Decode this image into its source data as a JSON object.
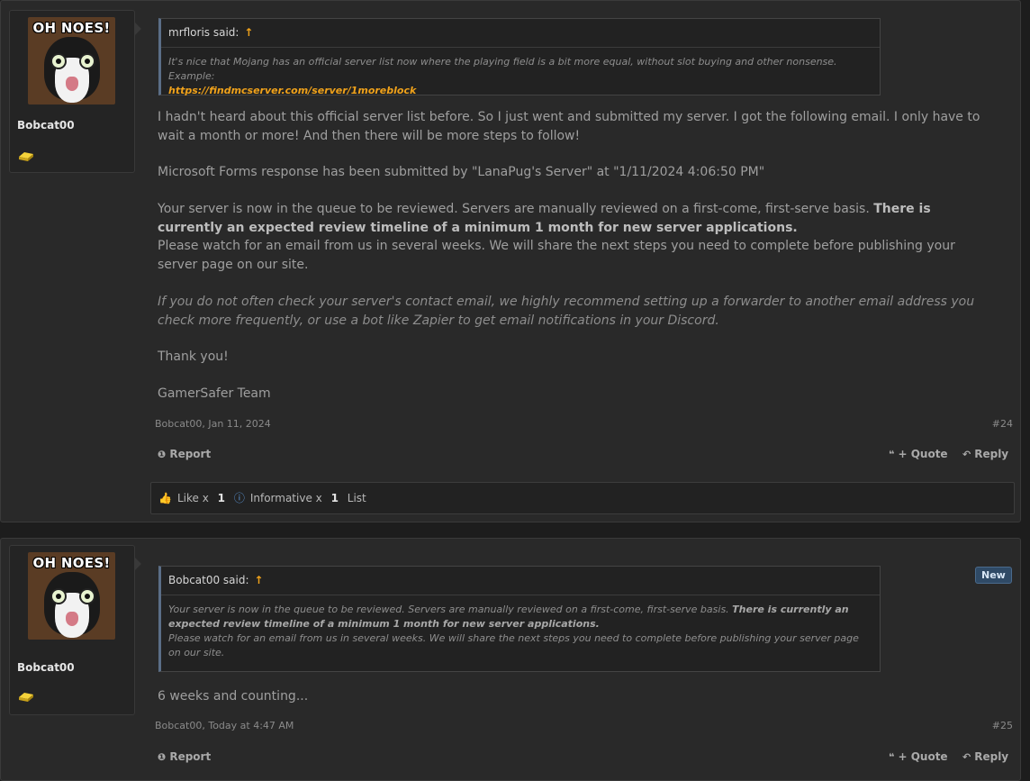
{
  "posts": [
    {
      "avatar_caption": "OH NOES!",
      "username": "Bobcat00",
      "quote": {
        "author": "mrfloris said:",
        "arrow": "↑",
        "text": "It's nice that Mojang has an official server list now where the playing field is a bit more equal, without slot buying and other nonsense. Example:",
        "link": "https://findmcserver.com/server/1moreblock"
      },
      "body": {
        "p1": "I hadn't heard about this official server list before. So I just went and submitted my server. I got the following email. I only have to wait a month or more! And then there will be more steps to follow!",
        "p2": "Microsoft Forms response has been submitted by \"LanaPug's Server\" at \"1/11/2024 4:06:50 PM\"",
        "p3_plain": "Your server is now in the queue to be reviewed. Servers are manually reviewed on a first-come, first-serve basis. ",
        "p3_bold": "There is currently an expected review timeline of a minimum 1 month for new server applications.",
        "p3_line2": "Please watch for an email from us in several weeks. We will share the next steps you need to complete before publishing your server page on our site.",
        "p4": "If you do not often check your server's contact email, we highly recommend setting up a forwarder to another email address you check more frequently, or use a bot like Zapier to get email notifications in your Discord.",
        "p5": "Thank you!",
        "p6": "GamerSafer Team"
      },
      "meta": "Bobcat00, Jan 11, 2024",
      "number": "#24",
      "report_label": "Report",
      "quote_label": "+ Quote",
      "reply_label": "Reply",
      "reactions": {
        "like_label": "Like x",
        "like_count": "1",
        "informative_label": "Informative x",
        "informative_count": "1",
        "list_label": "List"
      }
    },
    {
      "avatar_caption": "OH NOES!",
      "username": "Bobcat00",
      "new_badge": "New",
      "quote": {
        "author": "Bobcat00 said:",
        "arrow": "↑",
        "text_plain": "Your server is now in the queue to be reviewed. Servers are manually reviewed on a first-come, first-serve basis. ",
        "text_bold": "There is currently an expected review timeline of a minimum 1 month for new server applications.",
        "text_line2": "Please watch for an email from us in several weeks. We will share the next steps you need to complete before publishing your server page on our site."
      },
      "body": "6 weeks and counting...",
      "meta": "Bobcat00, Today at 4:47 AM",
      "number": "#25",
      "report_label": "Report",
      "quote_label": "+ Quote",
      "reply_label": "Reply"
    }
  ],
  "colors": {
    "accent_orange": "#f0a21b",
    "background": "#292929",
    "new_badge": "#2f4a66"
  },
  "icons": {
    "badge": "gold-ingot-icon",
    "report": "alert-circle-icon",
    "quote": "quote-marks-icon",
    "reply": "reply-arrow-icon",
    "like": "thumbs-up-icon",
    "informative": "info-icon"
  }
}
